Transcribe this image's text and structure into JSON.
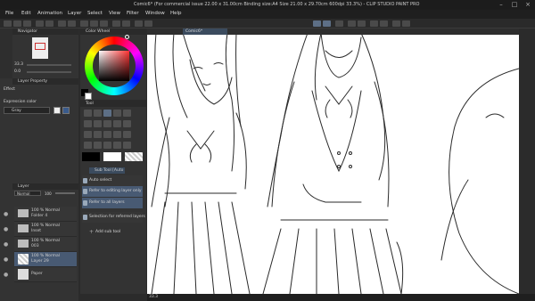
{
  "titlebar": {
    "title": "Comic6* (For commercial issue 22.00 x 31.00cm Binding size:A4 Size 21.00 x 29.70cm 600dpi 33.3%) - CLIP STUDIO PAINT PRO"
  },
  "menu": [
    "File",
    "Edit",
    "Animation",
    "Layer",
    "Select",
    "View",
    "Filter",
    "Window",
    "Help"
  ],
  "navigator": {
    "title": "Navigator",
    "zoom": "33.3",
    "angle": "0.0"
  },
  "layer_property": {
    "title": "Layer Property",
    "effect_label": "Effect",
    "expression_color_label": "Expression color",
    "expression_color_value": "Gray"
  },
  "color_wheel": {
    "title": "Color Wheel"
  },
  "tool": {
    "title": "Tool"
  },
  "sub_tool": {
    "title": "Sub Tool [Auto",
    "items": [
      {
        "label": "Auto select",
        "selected": false
      },
      {
        "label": "Refer to editing layer only",
        "selected": true
      },
      {
        "label": "Refer to all layers",
        "selected": true
      },
      {
        "label": "Selection for referred layers",
        "selected": false
      }
    ],
    "add_label": "Add sub tool"
  },
  "layer_panel": {
    "title": "Layer",
    "blend_mode": "Normal",
    "opacity": "100",
    "layers": [
      {
        "line1": "100 % Normal",
        "line2": "Folder 4",
        "type": "folder",
        "selected": false
      },
      {
        "line1": "100 % Normal",
        "line2": "Inset",
        "type": "folder",
        "selected": false
      },
      {
        "line1": "100 % Normal",
        "line2": "003",
        "type": "folder",
        "selected": false
      },
      {
        "line1": "100 % Normal",
        "line2": "Layer 29",
        "type": "raster",
        "selected": true
      },
      {
        "line1": "",
        "line2": "Paper",
        "type": "paper",
        "selected": false
      }
    ]
  },
  "canvas": {
    "tab_label": "Comic6*"
  },
  "statusbar": {
    "zoom": "33.3"
  },
  "colors": {
    "accent": "#485a73",
    "panel": "#333333",
    "canvas": "#ffffff",
    "line_art": "#2a2a2a"
  }
}
